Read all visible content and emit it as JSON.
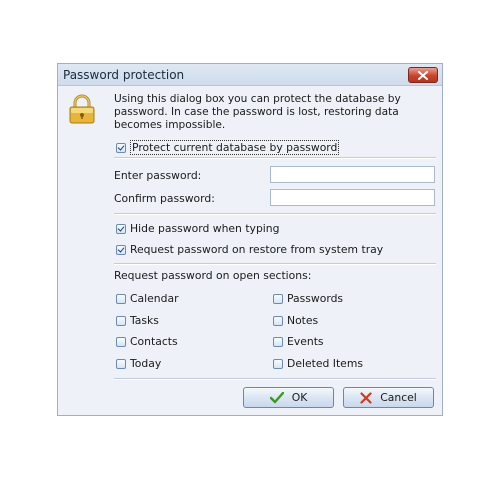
{
  "dialog": {
    "title": "Password protection",
    "intro": "Using this dialog box you can protect the database by password. In case the password is lost, restoring data becomes impossible.",
    "protect_checkbox": {
      "label": "Protect current database by password",
      "checked": true
    },
    "enter_password_label": "Enter password:",
    "confirm_password_label": "Confirm password:",
    "hide_password": {
      "label": "Hide password when typing",
      "checked": true
    },
    "request_on_restore": {
      "label": "Request password on restore from system tray",
      "checked": true
    },
    "sections_label": "Request password on open sections:",
    "sections": [
      {
        "label": "Calendar",
        "checked": false
      },
      {
        "label": "Passwords",
        "checked": false
      },
      {
        "label": "Tasks",
        "checked": false
      },
      {
        "label": "Notes",
        "checked": false
      },
      {
        "label": "Contacts",
        "checked": false
      },
      {
        "label": "Events",
        "checked": false
      },
      {
        "label": "Today",
        "checked": false
      },
      {
        "label": "Deleted Items",
        "checked": false
      }
    ],
    "ok_label": "OK",
    "cancel_label": "Cancel"
  },
  "icons": {
    "lock": "lock-icon",
    "close": "close-icon",
    "ok": "checkmark-icon",
    "cancel": "cross-icon"
  },
  "colors": {
    "dialog_bg": "#eef2f8",
    "close_button": "#c8452e",
    "ok_check": "#3a9a1e",
    "cancel_cross": "#d23a1e"
  }
}
